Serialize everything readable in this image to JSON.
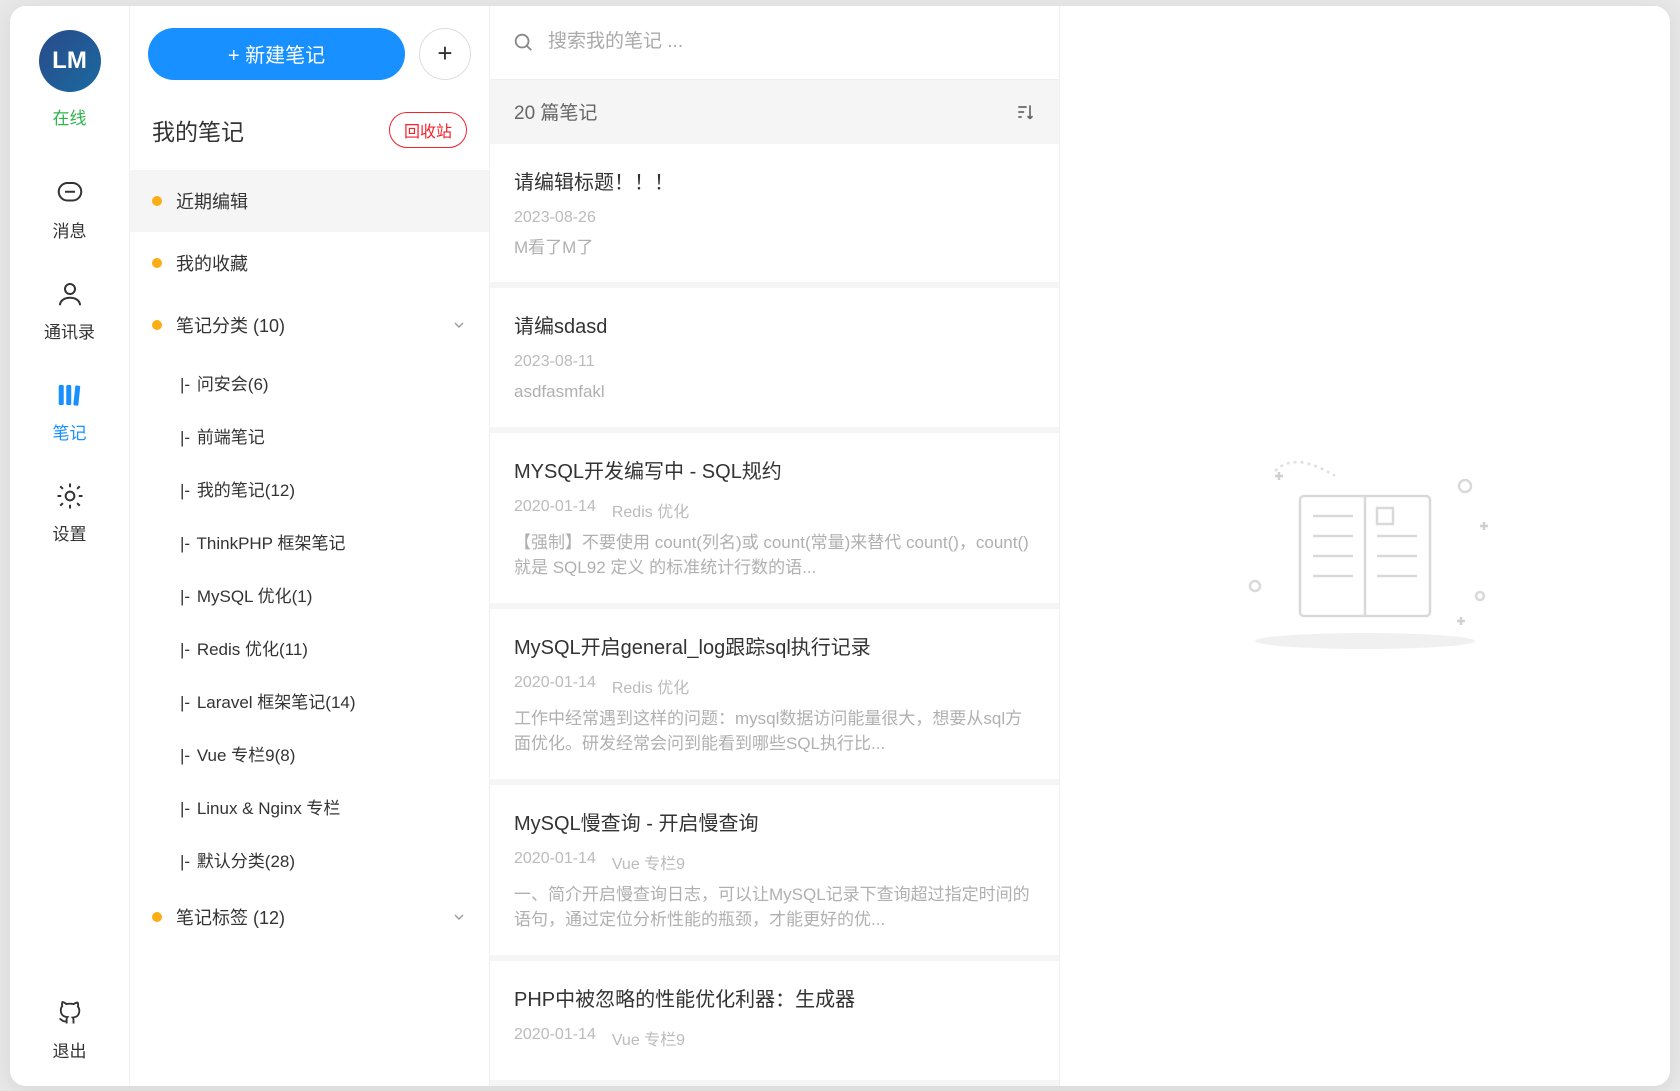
{
  "user": {
    "avatar_text": "LM",
    "status": "在线"
  },
  "nav_rail": {
    "items": [
      {
        "label": "消息",
        "icon": "message"
      },
      {
        "label": "通讯录",
        "icon": "contacts"
      },
      {
        "label": "笔记",
        "icon": "notes",
        "active": true
      },
      {
        "label": "设置",
        "icon": "settings"
      }
    ],
    "exit_label": "退出"
  },
  "sidebar": {
    "new_note_label": "+ 新建笔记",
    "my_notes_title": "我的笔记",
    "recycle_label": "回收站",
    "sections": [
      {
        "label": "近期编辑",
        "active": true
      },
      {
        "label": "我的收藏"
      },
      {
        "label": "笔记分类 (10)",
        "expandable": true,
        "expanded": true
      },
      {
        "label": "笔记标签 (12)",
        "expandable": true,
        "expanded": false
      }
    ],
    "categories": [
      {
        "label": "问安会(6)"
      },
      {
        "label": "前端笔记"
      },
      {
        "label": "我的笔记(12)"
      },
      {
        "label": "ThinkPHP 框架笔记"
      },
      {
        "label": "MySQL 优化(1)"
      },
      {
        "label": "Redis 优化(11)"
      },
      {
        "label": "Laravel 框架笔记(14)"
      },
      {
        "label": "Vue 专栏9(8)"
      },
      {
        "label": "Linux & Nginx 专栏"
      },
      {
        "label": "默认分类(28)"
      }
    ]
  },
  "search": {
    "placeholder": "搜索我的笔记 ..."
  },
  "notes": {
    "count_text": "20 篇笔记",
    "items": [
      {
        "title": "请编辑标题！！！",
        "date": "2023-08-26",
        "category": "",
        "preview": "M看了M了"
      },
      {
        "title": "请编sdasd",
        "date": "2023-08-11",
        "category": "",
        "preview": "asdfasmfakl"
      },
      {
        "title": "MYSQL开发编写中 - SQL规约",
        "date": "2020-01-14",
        "category": "Redis 优化",
        "preview": "【强制】不要使用 count(列名)或 count(常量)来替代 count()，count()就是 SQL92 定义 的标准统计行数的语..."
      },
      {
        "title": "MySQL开启general_log跟踪sql执行记录",
        "date": "2020-01-14",
        "category": "Redis 优化",
        "preview": "工作中经常遇到这样的问题：mysql数据访问能量很大，想要从sql方面优化。研发经常会问到能看到哪些SQL执行比..."
      },
      {
        "title": "MySQL慢查询 - 开启慢查询",
        "date": "2020-01-14",
        "category": "Vue 专栏9",
        "preview": "一、简介开启慢查询日志，可以让MySQL记录下查询超过指定时间的语句，通过定位分析性能的瓶颈，才能更好的优..."
      },
      {
        "title": "PHP中被忽略的性能优化利器：生成器",
        "date": "2020-01-14",
        "category": "Vue 专栏9",
        "preview": ""
      }
    ]
  }
}
